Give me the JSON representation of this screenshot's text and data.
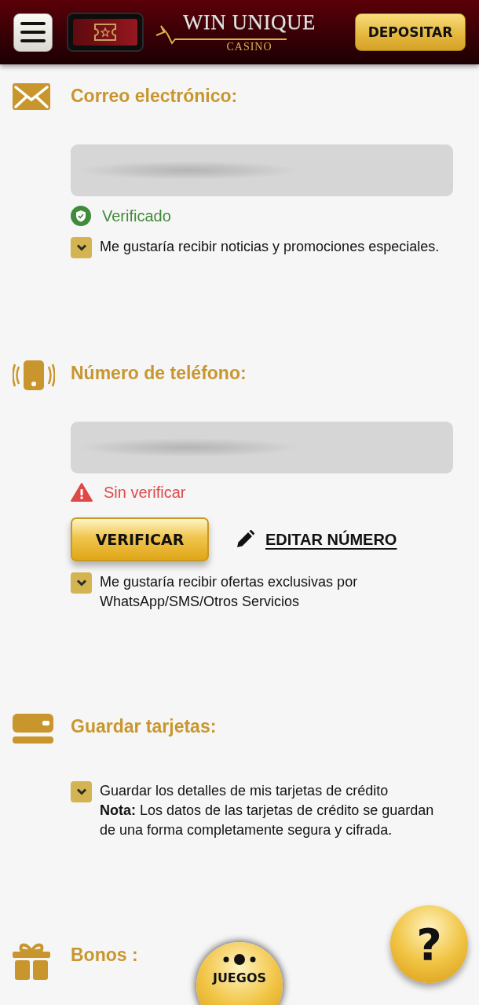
{
  "header": {
    "logo": {
      "name": "WIN UNIQUE",
      "subtitle": "CASINO"
    },
    "deposit_button": "DEPOSITAR"
  },
  "sections": [
    {
      "kind": "email",
      "title": "Correo electrónico:",
      "field": {
        "blurred": true
      },
      "status": {
        "kind": "verified",
        "label": "Verificado"
      },
      "options": [
        {
          "label": "Me gustaría recibir noticias y promociones especiales.",
          "checked": true
        }
      ]
    },
    {
      "kind": "phone",
      "title": "Número de teléfono:",
      "field": {
        "blurred": true
      },
      "status": {
        "kind": "unverified",
        "label": "Sin verificar"
      },
      "actions": {
        "verify_button": "VERIFICAR",
        "edit_link": "EDITAR NÚMERO"
      },
      "options": [
        {
          "label": "Me gustaría recibir ofertas exclusivas por WhatsApp/SMS/Otros Servicios",
          "checked": true
        }
      ]
    },
    {
      "kind": "cards",
      "title": "Guardar tarjetas:",
      "options": [
        {
          "label": "Guardar los detalles de mis tarjetas de crédito",
          "note": "**Nota:** Los datos de las tarjetas de crédito se guardan de una forma completamente segura y cifrada.",
          "checked": true
        }
      ]
    },
    {
      "kind": "bonus",
      "title": "Bonos :"
    }
  ],
  "floating": {
    "games_button": "JUEGOS",
    "help_button": "?"
  }
}
